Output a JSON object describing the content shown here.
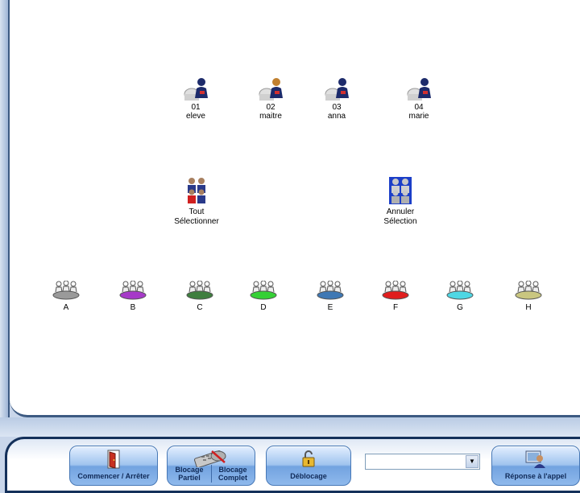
{
  "stations": [
    {
      "number": "01",
      "name": "eleve"
    },
    {
      "number": "02",
      "name": "maitre"
    },
    {
      "number": "03",
      "name": "anna"
    },
    {
      "number": "04",
      "name": "marie"
    }
  ],
  "select_all": {
    "line1": "Tout",
    "line2": "Sélectionner"
  },
  "cancel_selection": {
    "line1": "Annuler",
    "line2": "Sélection"
  },
  "groups": [
    {
      "label": "A",
      "color": "#9a9a9a"
    },
    {
      "label": "B",
      "color": "#a63ac8"
    },
    {
      "label": "C",
      "color": "#3f7e3f"
    },
    {
      "label": "D",
      "color": "#35d035"
    },
    {
      "label": "E",
      "color": "#3f78b4"
    },
    {
      "label": "F",
      "color": "#e01e1e"
    },
    {
      "label": "G",
      "color": "#4ed7e4"
    },
    {
      "label": "H",
      "color": "#c9c680"
    }
  ],
  "toolbar": {
    "start_stop": "Commencer / Arrêter",
    "blocage_partiel": "Blocage Partiel",
    "blocage_complet": "Blocage Complet",
    "deblocage": "Déblocage",
    "dropdown_value": "",
    "reponse": "Réponse à l'appel"
  }
}
